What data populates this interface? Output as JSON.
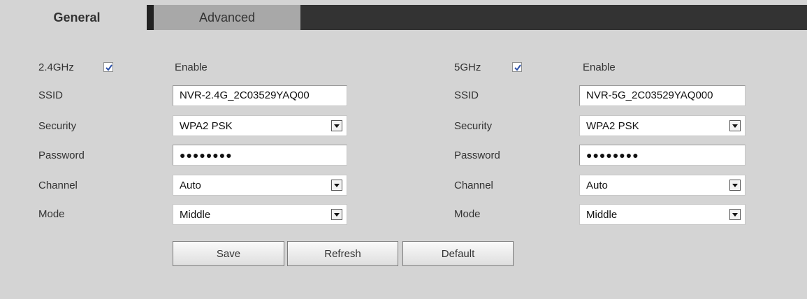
{
  "tabs": {
    "general": "General",
    "advanced": "Advanced"
  },
  "band24": {
    "label": "2.4GHz",
    "enabled": true,
    "enable_label": "Enable",
    "ssid_label": "SSID",
    "ssid_value": "NVR-2.4G_2C03529YAQ00",
    "security_label": "Security",
    "security_value": "WPA2 PSK",
    "password_label": "Password",
    "password_value": "●●●●●●●●",
    "channel_label": "Channel",
    "channel_value": "Auto",
    "mode_label": "Mode",
    "mode_value": "Middle"
  },
  "band5": {
    "label": "5GHz",
    "enabled": true,
    "enable_label": "Enable",
    "ssid_label": "SSID",
    "ssid_value": "NVR-5G_2C03529YAQ000",
    "security_label": "Security",
    "security_value": "WPA2 PSK",
    "password_label": "Password",
    "password_value": "●●●●●●●●",
    "channel_label": "Channel",
    "channel_value": "Auto",
    "mode_label": "Mode",
    "mode_value": "Middle"
  },
  "buttons": {
    "save": "Save",
    "refresh": "Refresh",
    "default": "Default"
  },
  "colors": {
    "background": "#d4d4d4",
    "tabbar_dark": "#333333",
    "tab_inactive": "#a8a8a8",
    "checkmark": "#2a4fa8"
  },
  "icons": {
    "checkbox": "checkbox-checked-icon",
    "dropdown": "chevron-down-icon"
  }
}
